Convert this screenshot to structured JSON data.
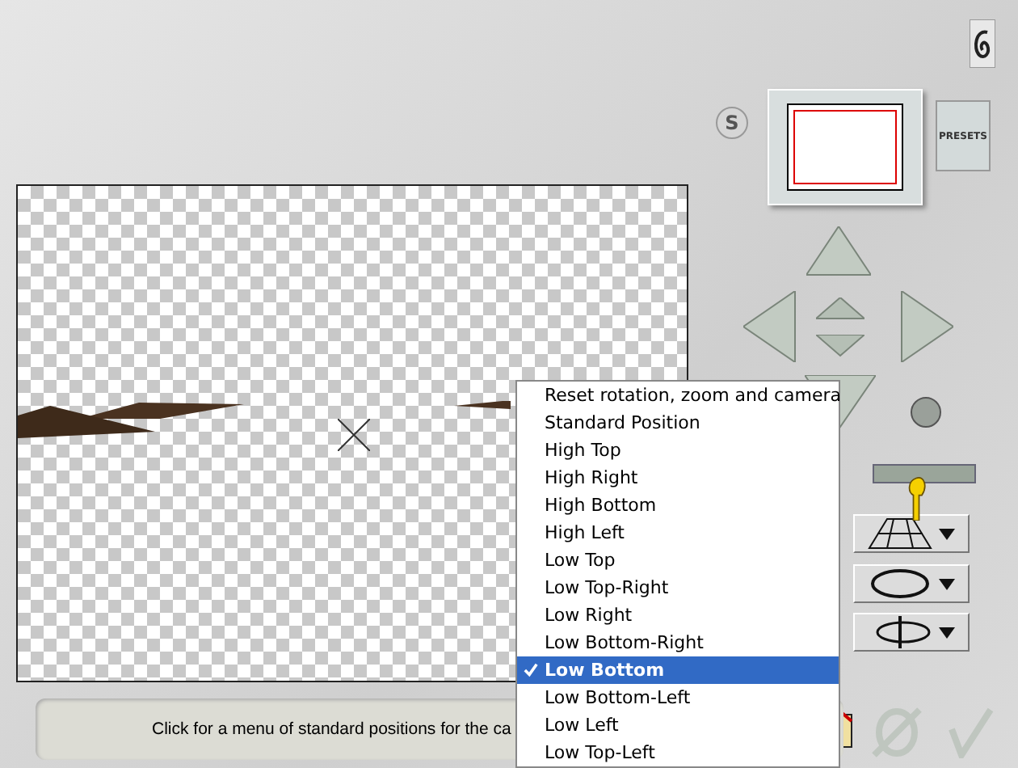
{
  "header": {
    "style_button": "S",
    "presets_button": "PRESETS"
  },
  "status_bar": {
    "text": "Click for a menu of standard positions for the ca"
  },
  "menu": {
    "items": [
      {
        "label": "Reset rotation, zoom and camera",
        "checked": false,
        "selected": false
      },
      {
        "label": "Standard Position",
        "checked": false,
        "selected": false
      },
      {
        "label": "High Top",
        "checked": false,
        "selected": false
      },
      {
        "label": "High Right",
        "checked": false,
        "selected": false
      },
      {
        "label": "High Bottom",
        "checked": false,
        "selected": false
      },
      {
        "label": "High Left",
        "checked": false,
        "selected": false
      },
      {
        "label": "Low Top",
        "checked": false,
        "selected": false
      },
      {
        "label": "Low Top-Right",
        "checked": false,
        "selected": false
      },
      {
        "label": "Low Right",
        "checked": false,
        "selected": false
      },
      {
        "label": "Low Bottom-Right",
        "checked": false,
        "selected": false
      },
      {
        "label": "Low Bottom",
        "checked": true,
        "selected": true
      },
      {
        "label": "Low Bottom-Left",
        "checked": false,
        "selected": false
      },
      {
        "label": "Low Left",
        "checked": false,
        "selected": false
      },
      {
        "label": "Low Top-Left",
        "checked": false,
        "selected": false
      }
    ]
  }
}
